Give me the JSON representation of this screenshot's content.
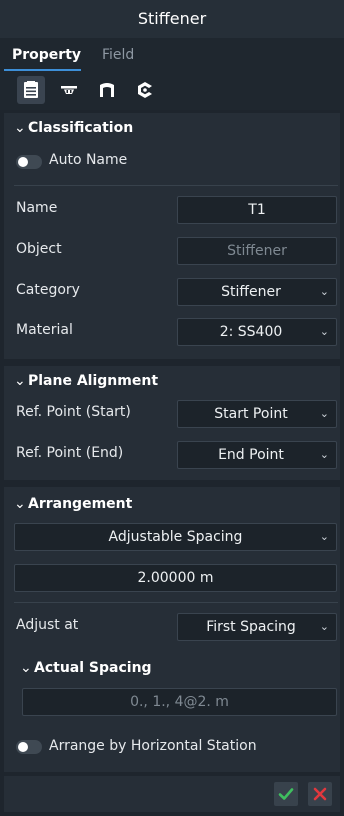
{
  "window": {
    "title": "Stiffener"
  },
  "tabs": [
    {
      "label": "Property",
      "active": true
    },
    {
      "label": "Field",
      "active": false
    }
  ],
  "toolbar_icons": [
    "property-sheet-icon",
    "stiffener-profile-icon",
    "arch-icon",
    "connection-icon"
  ],
  "classification": {
    "header": "Classification",
    "auto_name": {
      "label": "Auto Name",
      "on": false
    },
    "name": {
      "label": "Name",
      "value": "T1"
    },
    "object": {
      "label": "Object",
      "value": "Stiffener"
    },
    "category": {
      "label": "Category",
      "value": "Stiffener"
    },
    "material": {
      "label": "Material",
      "value": "2: SS400"
    }
  },
  "plane_alignment": {
    "header": "Plane Alignment",
    "ref_start": {
      "label": "Ref. Point (Start)",
      "value": "Start Point"
    },
    "ref_end": {
      "label": "Ref. Point (End)",
      "value": "End Point"
    }
  },
  "arrangement": {
    "header": "Arrangement",
    "type": "Adjustable Spacing",
    "spacing": "2.00000 m",
    "adjust_at": {
      "label": "Adjust at",
      "value": "First Spacing"
    },
    "actual_spacing": {
      "header": "Actual Spacing",
      "value": "0., 1., 4@2. m"
    },
    "arrange_by_station": {
      "label": "Arrange by Horizontal Station",
      "on": false
    }
  },
  "colors": {
    "accent": "#3d8fd8",
    "ok": "#3fbf5f",
    "cancel": "#e0383e"
  }
}
